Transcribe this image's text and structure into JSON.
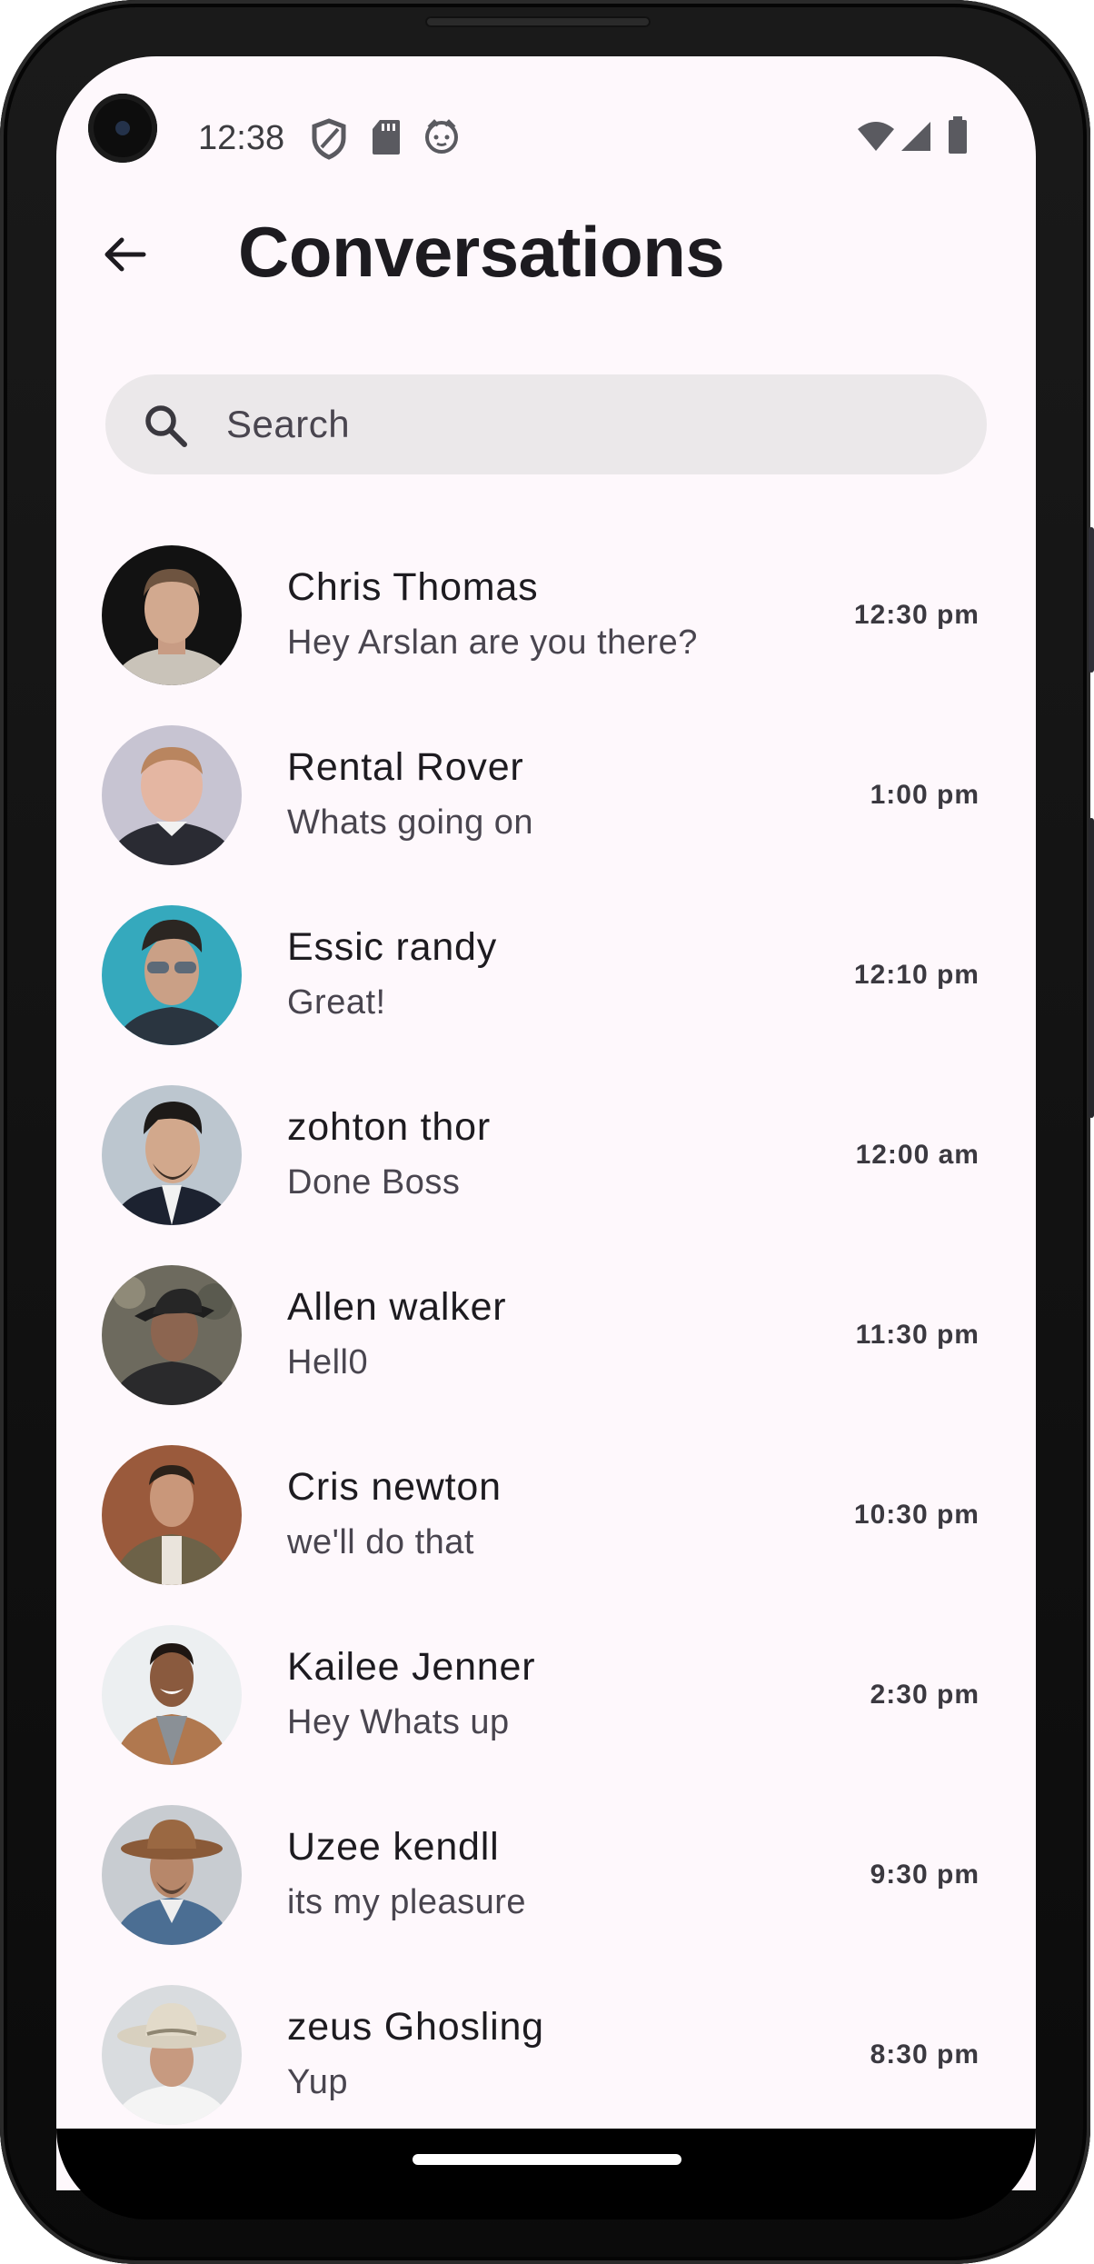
{
  "status_bar": {
    "time": "12:38",
    "icons": [
      "shield-icon",
      "sd-card-icon",
      "cat-face-icon"
    ],
    "right_icons": [
      "wifi-icon",
      "signal-icon",
      "battery-icon"
    ]
  },
  "app_bar": {
    "back_icon": "arrow-left-icon",
    "title": "Conversations"
  },
  "search": {
    "placeholder": "Search",
    "value": ""
  },
  "conversations": [
    {
      "name": "Chris Thomas",
      "message": "Hey Arslan are you there?",
      "time": "12:30 pm"
    },
    {
      "name": "Rental Rover",
      "message": "Whats going on",
      "time": "1:00 pm"
    },
    {
      "name": "Essic randy",
      "message": "Great!",
      "time": "12:10 pm"
    },
    {
      "name": "zohton thor",
      "message": "Done Boss",
      "time": "12:00 am"
    },
    {
      "name": "Allen walker",
      "message": "Hell0",
      "time": "11:30 pm"
    },
    {
      "name": "Cris newton",
      "message": "we'll do that",
      "time": "10:30 pm"
    },
    {
      "name": "Kailee Jenner",
      "message": "Hey Whats up",
      "time": "2:30 pm"
    },
    {
      "name": "Uzee kendll",
      "message": "its my pleasure",
      "time": "9:30 pm"
    },
    {
      "name": "zeus Ghosling",
      "message": "Yup",
      "time": "8:30 pm"
    }
  ],
  "colors": {
    "background": "#fef8fc",
    "search_fill": "#ebe8ea",
    "title_text": "#1d1b20",
    "secondary_text": "#49454f"
  }
}
